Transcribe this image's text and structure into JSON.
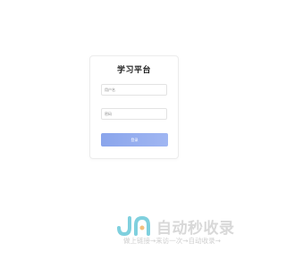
{
  "login": {
    "title": "学习平台",
    "username_placeholder": "用户名",
    "password_placeholder": "密码",
    "submit_label": "登录"
  },
  "watermark": {
    "brand": "自动秒收录",
    "tagline": "做上链接→来访一次→自动收录→"
  },
  "colors": {
    "button_start": "#8aa5ec",
    "button_end": "#a0b6f2",
    "watermark_logo_primary": "#7fd0de",
    "watermark_logo_secondary": "#f3c07e"
  }
}
